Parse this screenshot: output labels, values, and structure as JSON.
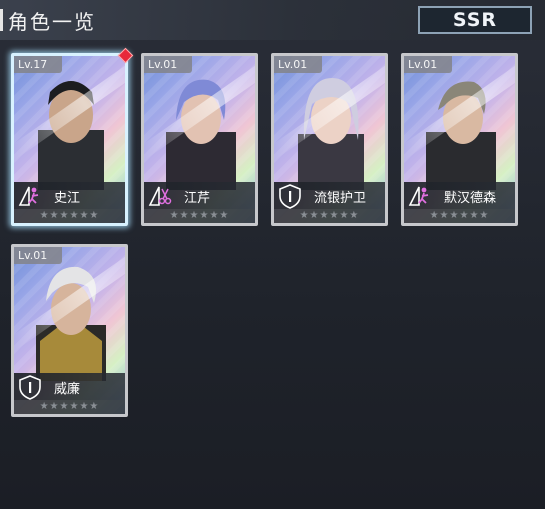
{
  "header": {
    "title": "角色一览",
    "rarity_label": "SSR"
  },
  "cards": [
    {
      "level": "Lv.17",
      "name": "史江",
      "role_icon": "assault-figure-icon",
      "stars": "★★★★★★",
      "selected": true
    },
    {
      "level": "Lv.01",
      "name": "江芹",
      "role_icon": "scissors-icon",
      "stars": "★★★★★★",
      "selected": false
    },
    {
      "level": "Lv.01",
      "name": "流银护卫",
      "role_icon": "shield-icon",
      "stars": "★★★★★★",
      "selected": false
    },
    {
      "level": "Lv.01",
      "name": "默汉德森",
      "role_icon": "assault-figure-icon",
      "stars": "★★★★★★",
      "selected": false
    },
    {
      "level": "Lv.01",
      "name": "威廉",
      "role_icon": "shield-icon",
      "stars": "★★★★★★",
      "selected": false
    }
  ],
  "colors": {
    "selected_glow": "#aee1ff",
    "new_badge": "#e8283a"
  }
}
